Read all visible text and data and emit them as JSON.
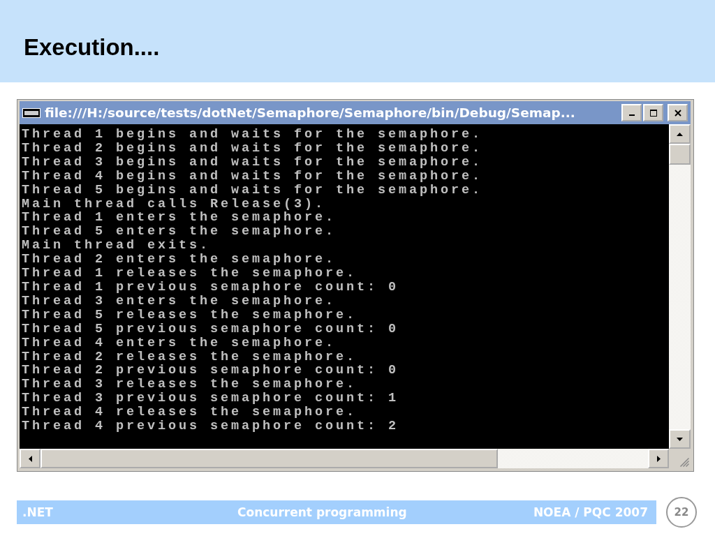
{
  "slide": {
    "title": "Execution...."
  },
  "window": {
    "title": "file:///H:/source/tests/dotNet/Semaphore/Semaphore/bin/Debug/Semap..."
  },
  "console_lines": [
    "Thread 1 begins and waits for the semaphore.",
    "Thread 2 begins and waits for the semaphore.",
    "Thread 3 begins and waits for the semaphore.",
    "Thread 4 begins and waits for the semaphore.",
    "Thread 5 begins and waits for the semaphore.",
    "Main thread calls Release(3).",
    "Thread 1 enters the semaphore.",
    "Thread 5 enters the semaphore.",
    "Main thread exits.",
    "Thread 2 enters the semaphore.",
    "Thread 1 releases the semaphore.",
    "Thread 1 previous semaphore count: 0",
    "Thread 3 enters the semaphore.",
    "Thread 5 releases the semaphore.",
    "Thread 5 previous semaphore count: 0",
    "Thread 4 enters the semaphore.",
    "Thread 2 releases the semaphore.",
    "Thread 2 previous semaphore count: 0",
    "Thread 3 releases the semaphore.",
    "Thread 3 previous semaphore count: 1",
    "Thread 4 releases the semaphore.",
    "Thread 4 previous semaphore count: 2"
  ],
  "footer": {
    "left": ".NET",
    "center": "Concurrent programming",
    "right": "NOEA / PQC 2007",
    "page": "22"
  }
}
